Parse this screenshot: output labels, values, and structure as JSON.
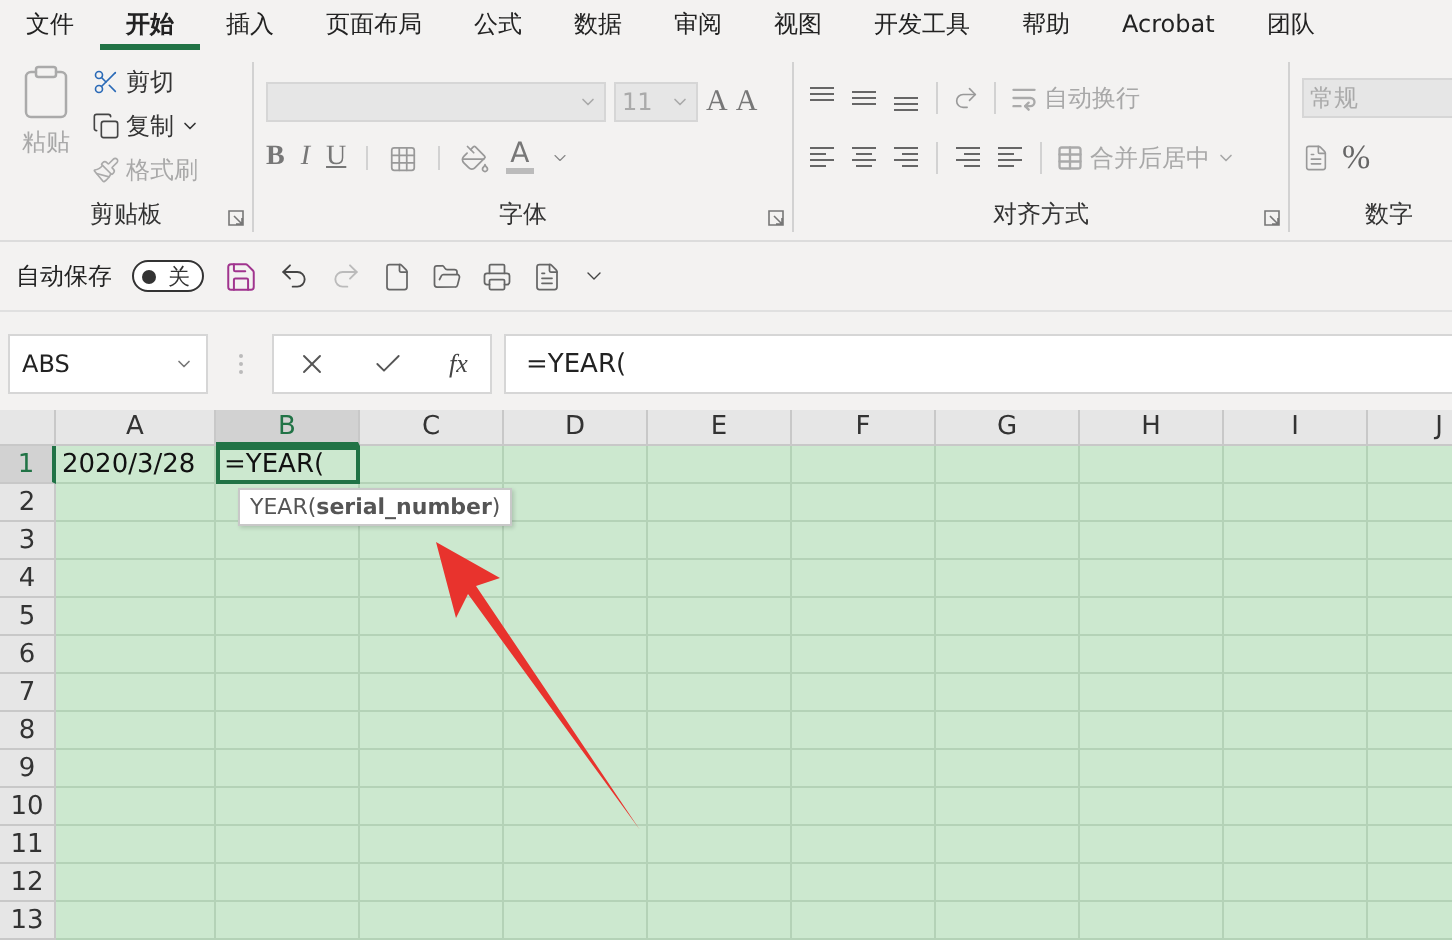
{
  "menu_tabs": [
    {
      "label": "文件",
      "selected": false
    },
    {
      "label": "开始",
      "selected": true
    },
    {
      "label": "插入",
      "selected": false
    },
    {
      "label": "页面布局",
      "selected": false
    },
    {
      "label": "公式",
      "selected": false
    },
    {
      "label": "数据",
      "selected": false
    },
    {
      "label": "审阅",
      "selected": false
    },
    {
      "label": "视图",
      "selected": false
    },
    {
      "label": "开发工具",
      "selected": false
    },
    {
      "label": "帮助",
      "selected": false
    },
    {
      "label": "Acrobat",
      "selected": false
    },
    {
      "label": "团队",
      "selected": false
    }
  ],
  "ribbon": {
    "clipboard": {
      "title": "剪贴板",
      "paste": {
        "label": "粘贴",
        "disabled": true
      },
      "cut": {
        "label": "剪切",
        "disabled": false
      },
      "copy": {
        "label": "复制",
        "disabled": false
      },
      "format_painter": {
        "label": "格式刷",
        "disabled": true
      }
    },
    "font": {
      "title": "字体",
      "font_size": "11",
      "grow_font": "A",
      "shrink_font": "A",
      "bold": "B",
      "italic": "I",
      "underline": "U",
      "font_color": "A"
    },
    "alignment": {
      "title": "对齐方式",
      "wrap_text": {
        "label": "自动换行",
        "disabled": true
      },
      "merge_center": {
        "label": "合并后居中",
        "disabled": true
      }
    },
    "number": {
      "title": "数字",
      "format": "常规",
      "percent": "%"
    }
  },
  "quick_access": {
    "autosave_label": "自动保存",
    "autosave_toggle": {
      "label": "关",
      "on": false
    }
  },
  "formula_bar": {
    "name_box": "ABS",
    "fx": "fx",
    "formula": "=YEAR("
  },
  "sheet": {
    "columns": [
      {
        "label": "A",
        "selected": false
      },
      {
        "label": "B",
        "selected": true
      },
      {
        "label": "C",
        "selected": false
      },
      {
        "label": "D",
        "selected": false
      },
      {
        "label": "E",
        "selected": false
      },
      {
        "label": "F",
        "selected": false
      },
      {
        "label": "G",
        "selected": false
      },
      {
        "label": "H",
        "selected": false
      },
      {
        "label": "I",
        "selected": false
      },
      {
        "label": "J",
        "selected": false
      }
    ],
    "rows": [
      {
        "label": "1",
        "selected": true,
        "cells": [
          "2020/3/28",
          "=YEAR("
        ]
      },
      {
        "label": "2",
        "selected": false,
        "cells": []
      },
      {
        "label": "3",
        "selected": false,
        "cells": []
      },
      {
        "label": "4",
        "selected": false,
        "cells": []
      },
      {
        "label": "5",
        "selected": false,
        "cells": []
      },
      {
        "label": "6",
        "selected": false,
        "cells": []
      },
      {
        "label": "7",
        "selected": false,
        "cells": []
      },
      {
        "label": "8",
        "selected": false,
        "cells": []
      },
      {
        "label": "9",
        "selected": false,
        "cells": []
      },
      {
        "label": "10",
        "selected": false,
        "cells": []
      },
      {
        "label": "11",
        "selected": false,
        "cells": []
      },
      {
        "label": "12",
        "selected": false,
        "cells": []
      },
      {
        "label": "13",
        "selected": false,
        "cells": []
      }
    ],
    "tooltip": "YEAR(**serial_number**)"
  }
}
